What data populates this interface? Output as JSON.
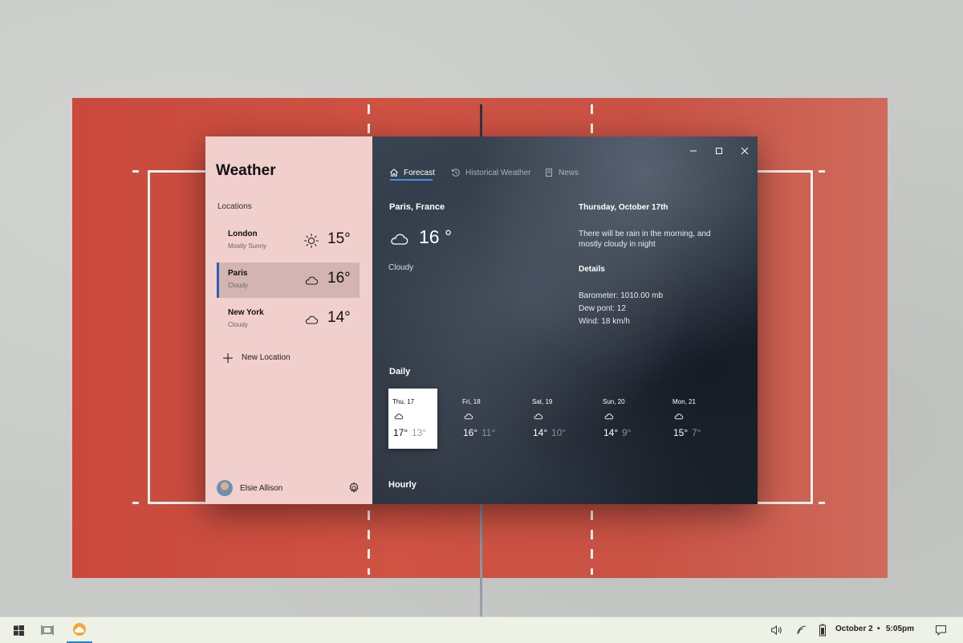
{
  "app": {
    "title": "Weather",
    "locations_label": "Locations",
    "new_location_label": "New Location",
    "user_name": "Elsie Allison",
    "accent": "#2a62b8"
  },
  "locations": [
    {
      "name": "London",
      "condition": "Mostly Sunny",
      "temp": "15°",
      "icon": "sun-icon",
      "selected": false
    },
    {
      "name": "Paris",
      "condition": "Cloudy",
      "temp": "16°",
      "icon": "cloud-icon",
      "selected": true
    },
    {
      "name": "New York",
      "condition": "Cloudy",
      "temp": "14°",
      "icon": "cloud-icon",
      "selected": false
    }
  ],
  "tabs": [
    {
      "label": "Forecast",
      "icon": "home-icon",
      "active": true
    },
    {
      "label": "Historical Weather",
      "icon": "history-icon",
      "active": false
    },
    {
      "label": "News",
      "icon": "news-icon",
      "active": false
    }
  ],
  "current": {
    "city": "Paris, France",
    "temp": "16 °",
    "condition": "Cloudy",
    "date": "Thursday, October 17th",
    "description": "There will be rain in the morning, and mostly cloudy in night",
    "details_label": "Details",
    "barometer": "Barometer: 1010.00 mb",
    "dew_point": "Dew pont: 12",
    "wind": "Wind: 18 km/h"
  },
  "daily_label": "Daily",
  "daily": [
    {
      "day": "Thu, 17",
      "hi": "17°",
      "lo": "13°",
      "icon": "cloud-icon",
      "selected": true
    },
    {
      "day": "Fri, 18",
      "hi": "16°",
      "lo": "11°",
      "icon": "cloud-icon",
      "selected": false
    },
    {
      "day": "Sat, 19",
      "hi": "14°",
      "lo": "10°",
      "icon": "cloud-icon",
      "selected": false
    },
    {
      "day": "Sun, 20",
      "hi": "14°",
      "lo": "9°",
      "icon": "cloud-icon",
      "selected": false
    },
    {
      "day": "Mon, 21",
      "hi": "15°",
      "lo": "7°",
      "icon": "cloud-icon",
      "selected": false
    }
  ],
  "hourly_label": "Hourly",
  "taskbar": {
    "date": "October 2",
    "separator": "•",
    "time": "5:05pm"
  }
}
